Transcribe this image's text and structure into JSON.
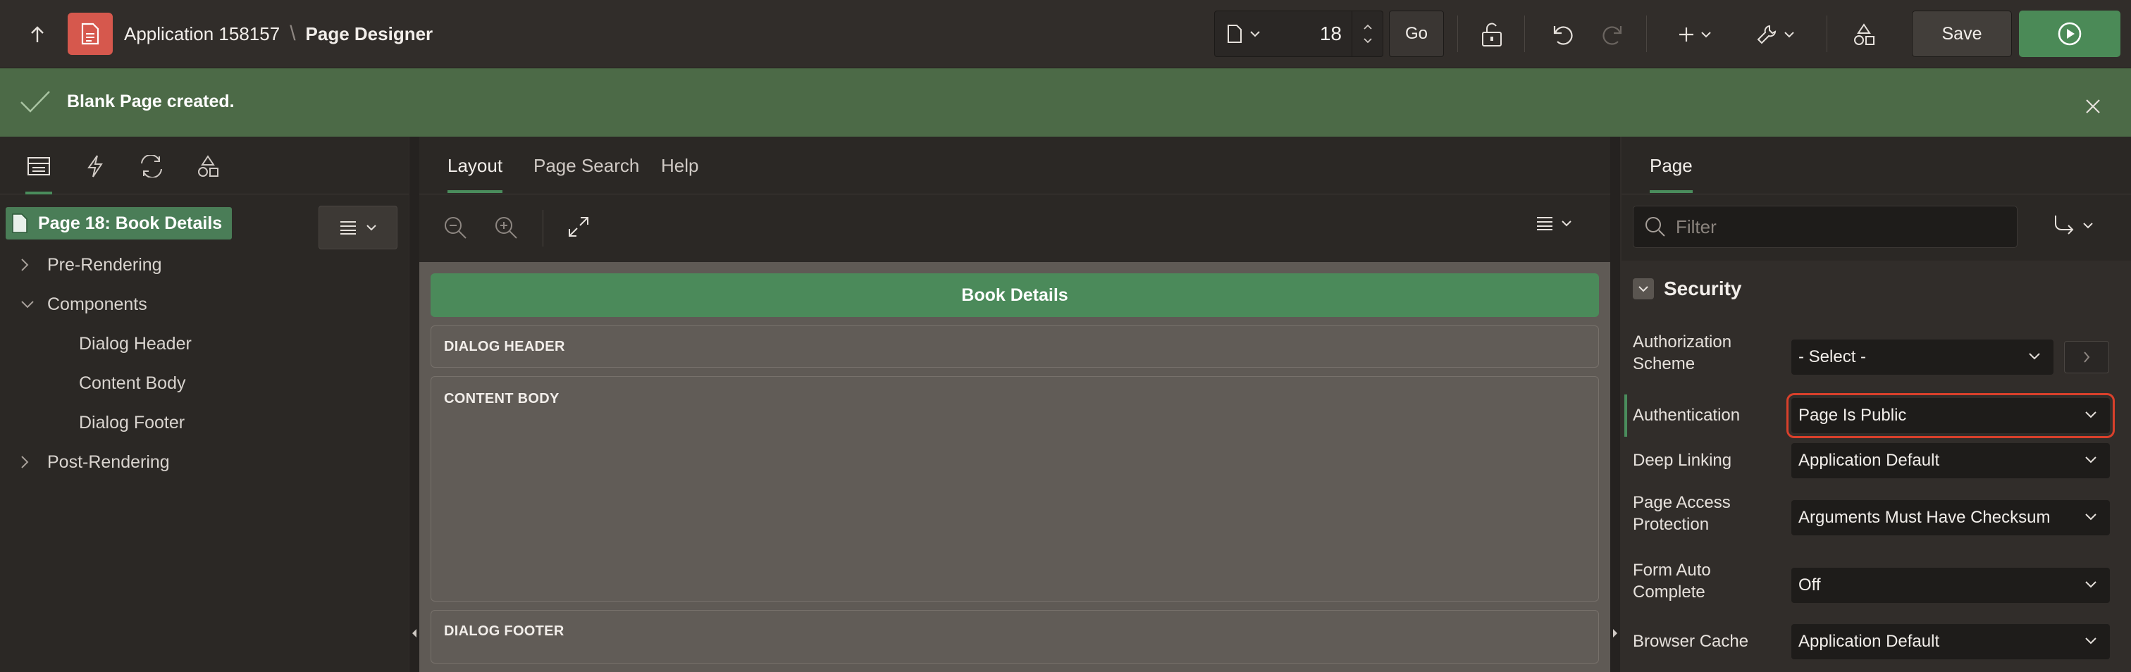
{
  "header": {
    "app_name": "Application 158157",
    "separator": "\\",
    "page_designer": "Page Designer",
    "page_number": "18",
    "go_label": "Go",
    "save_label": "Save"
  },
  "banner": {
    "message": "Blank Page created."
  },
  "left_pane": {
    "tree_root": "Page 18: Book Details",
    "nodes": {
      "pre_rendering": "Pre-Rendering",
      "components": "Components",
      "dialog_header": "Dialog Header",
      "content_body": "Content Body",
      "dialog_footer": "Dialog Footer",
      "post_rendering": "Post-Rendering"
    }
  },
  "center_pane": {
    "tabs": {
      "layout": "Layout",
      "page_search": "Page Search",
      "help": "Help"
    },
    "page_title": "Book Details",
    "regions": {
      "dialog_header": "DIALOG HEADER",
      "content_body": "CONTENT BODY",
      "dialog_footer": "DIALOG FOOTER"
    }
  },
  "right_pane": {
    "tab": "Page",
    "filter_placeholder": "Filter",
    "section": "Security",
    "properties": {
      "auth_scheme_label": "Authorization Scheme",
      "auth_scheme_value": "- Select -",
      "authentication_label": "Authentication",
      "authentication_value": "Page Is Public",
      "deep_linking_label": "Deep Linking",
      "deep_linking_value": "Application Default",
      "page_access_label": "Page Access Protection",
      "page_access_value": "Arguments Must Have Checksum",
      "form_auto_label": "Form Auto Complete",
      "form_auto_value": "Off",
      "browser_cache_label": "Browser Cache",
      "browser_cache_value": "Application Default"
    }
  },
  "colors": {
    "accent_green": "#4b8a57",
    "banner_green": "#4c6a47",
    "highlight_red": "#d9402b",
    "app_icon_red": "#d6584d"
  }
}
